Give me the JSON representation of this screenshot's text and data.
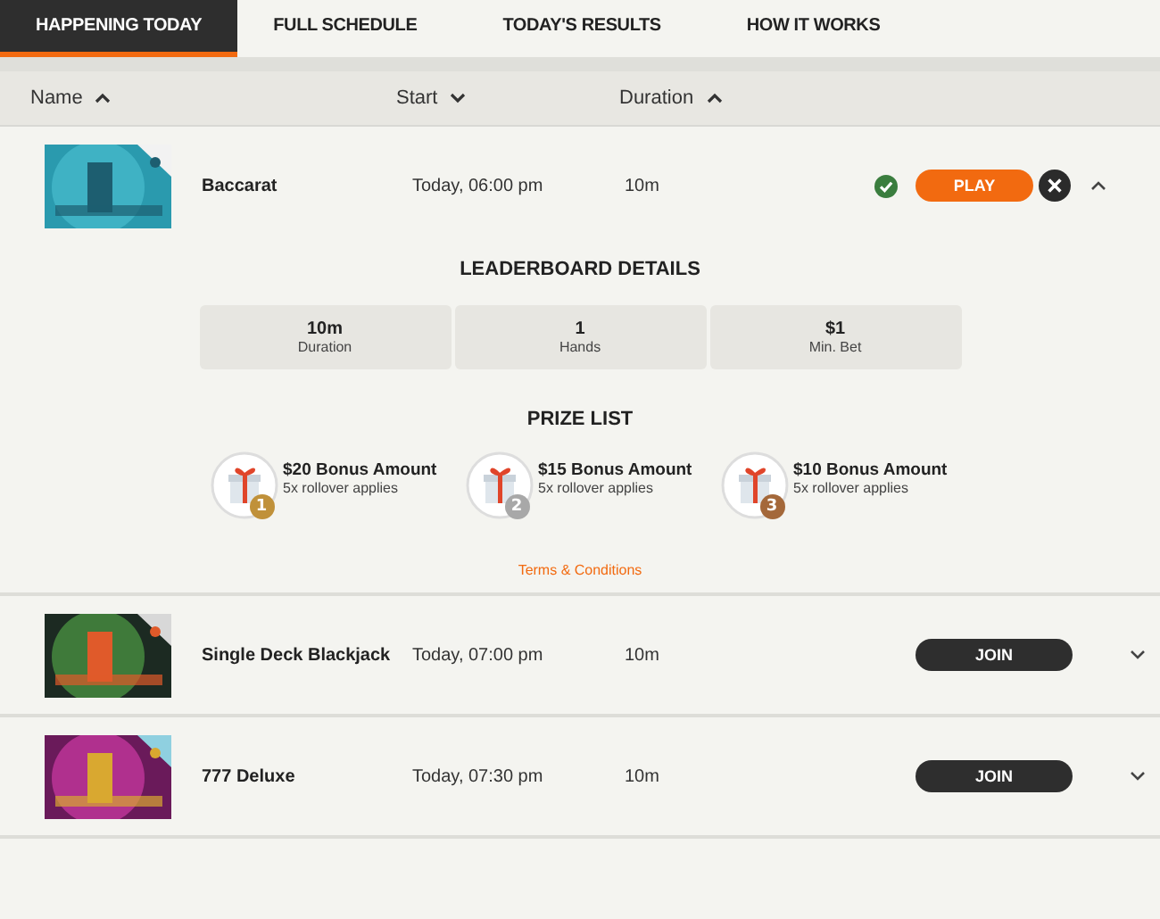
{
  "tabs": [
    {
      "label": "HAPPENING TODAY",
      "selected": true
    },
    {
      "label": "FULL SCHEDULE",
      "selected": false
    },
    {
      "label": "TODAY'S RESULTS",
      "selected": false
    },
    {
      "label": "HOW IT WORKS",
      "selected": false
    }
  ],
  "columns": [
    {
      "label": "Name",
      "ascending": true
    },
    {
      "label": "Start",
      "ascending": false
    },
    {
      "label": "Duration",
      "ascending": true
    }
  ],
  "rows": [
    {
      "name": "Baccarat",
      "start": "Today, 06:00 pm",
      "duration": "10m",
      "joined": true,
      "action": {
        "label": "PLAY",
        "kind": "play"
      },
      "expanded": true,
      "details": {
        "title": "LEADERBOARD DETAILS",
        "stats": [
          {
            "value": "10m",
            "label": "Duration"
          },
          {
            "value": "1",
            "label": "Hands"
          },
          {
            "value": "$1",
            "label": "Min. Bet"
          }
        ],
        "prize_title": "PRIZE LIST",
        "prizes": [
          {
            "rank": "1",
            "color": "#c0913a",
            "amount": "$20 Bonus Amount",
            "note": "5x rollover applies"
          },
          {
            "rank": "2",
            "color": "#a8a8a8",
            "amount": "$15 Bonus Amount",
            "note": "5x rollover applies"
          },
          {
            "rank": "3",
            "color": "#a4683a",
            "amount": "$10 Bonus Amount",
            "note": "5x rollover applies"
          }
        ],
        "terms": "Terms & Conditions"
      }
    },
    {
      "name": "Single Deck Blackjack",
      "start": "Today, 07:00 pm",
      "duration": "10m",
      "joined": false,
      "action": {
        "label": "JOIN",
        "kind": "join"
      },
      "expanded": false
    },
    {
      "name": "777 Deluxe",
      "start": "Today, 07:30 pm",
      "duration": "10m",
      "joined": false,
      "action": {
        "label": "JOIN",
        "kind": "join"
      },
      "expanded": false
    }
  ]
}
